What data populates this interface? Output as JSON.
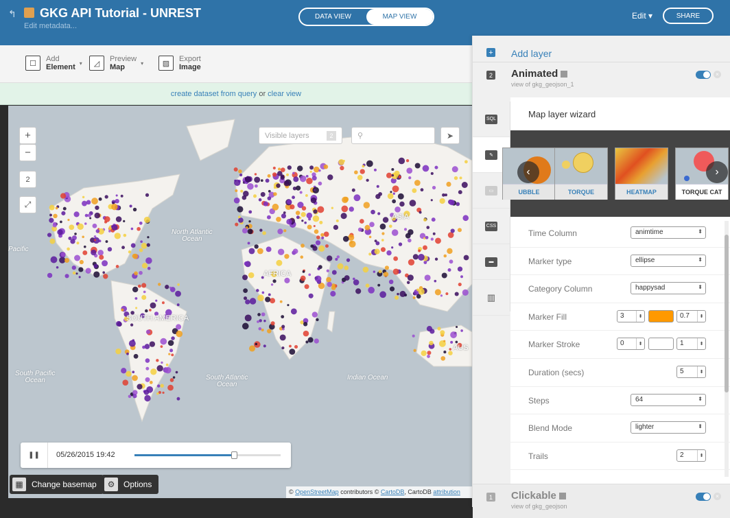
{
  "header": {
    "back_icon": "back-arrow-icon",
    "title": "GKG API Tutorial - UNREST",
    "subtitle": "Edit metadata...",
    "views": [
      "DATA VIEW",
      "MAP VIEW"
    ],
    "active_view": "MAP VIEW",
    "edit_label": "Edit ▾",
    "share_label": "SHARE"
  },
  "toolbar": {
    "add": {
      "top": "Add",
      "bottom": "Element"
    },
    "preview": {
      "top": "Preview",
      "bottom": "Map"
    },
    "export": {
      "top": "Export",
      "bottom": "Image"
    }
  },
  "infobar": {
    "link1": "create dataset from query",
    "mid": " or ",
    "link2": "clear view"
  },
  "map": {
    "zoom_in": "+",
    "zoom_out": "−",
    "zoom_level": "2",
    "fullscreen": "⤢",
    "visible_layers_label": "Visible layers",
    "visible_layers_count": "2",
    "search_placeholder": "",
    "labels": {
      "north_atlantic": "North Atlantic\nOcean",
      "south_pacific": "South Pacific\nOcean",
      "south_atlantic": "South Atlantic\nOcean",
      "indian": "Indian Ocean",
      "pacific": "Pacific",
      "asia": "ASIA",
      "africa": "AFRICA",
      "south_america": "SOUTH AMERICA",
      "aus": "AUS"
    },
    "time_slider": {
      "play_icon": "pause-icon",
      "time": "05/26/2015 19:42",
      "progress": 0.68
    },
    "change_basemap": "Change basemap",
    "options": "Options",
    "attribution": {
      "prefix": "© ",
      "osm": "OpenStreetMap",
      "mid": " contributors © ",
      "carto": "CartoDB",
      "mid2": ", CartoDB ",
      "attr": "attribution"
    }
  },
  "panel": {
    "add_layer": "Add layer",
    "layer2": {
      "num": "2",
      "name": "Animated",
      "view": "view of gkg_geojson_1"
    },
    "layer1": {
      "num": "1",
      "name": "Clickable",
      "view": "view of gkg_geojson"
    },
    "wizard_title": "Map layer wizard",
    "thumbs": [
      "UBBLE",
      "TORQUE",
      "HEATMAP",
      "TORQUE CAT"
    ],
    "settings": [
      {
        "label": "Time Column",
        "value": "animtime"
      },
      {
        "label": "Marker type",
        "value": "ellipse"
      },
      {
        "label": "Category Column",
        "value": "happysad"
      },
      {
        "label": "Marker Fill",
        "width": "3",
        "opacity": "0.7"
      },
      {
        "label": "Marker Stroke",
        "width": "0",
        "opacity": "1"
      },
      {
        "label": "Duration (secs)",
        "value": "5"
      },
      {
        "label": "Steps",
        "value": "64"
      },
      {
        "label": "Blend Mode",
        "value": "lighter"
      },
      {
        "label": "Trails",
        "value": "2"
      }
    ],
    "colors": {
      "fill": "#ff9900",
      "accent": "#3780b8"
    }
  }
}
